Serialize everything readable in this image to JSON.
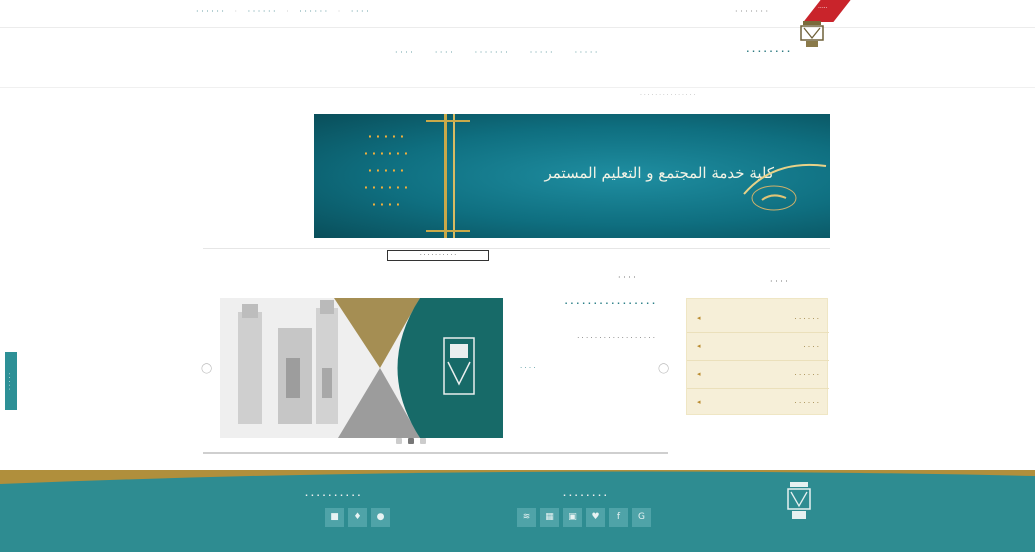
{
  "utility_bar": {
    "right_text": "· · · · · · ·",
    "ribbon": "·····",
    "links": [
      "· · · · · ·",
      "·",
      "· · · · · ·",
      "·",
      "· · · · · ·",
      "·",
      "· · · ·"
    ]
  },
  "header": {
    "university_name": "· · · · · · · ·",
    "nav": [
      "· · · · ·",
      "· · · · ·",
      "· · · · · · ·",
      "· · · ·",
      "· · · ·"
    ]
  },
  "breadcrumb": "· · · · · · · · · · · · · · ·",
  "banner": {
    "title": "كلية خدمة المجتمع و التعليم المستمر",
    "left_lines": [
      "· · · · ·",
      "· · · · · ·",
      "· · · · ·",
      "· · · · · ·",
      "· · · ·"
    ]
  },
  "caption": "· · · · · · · · · ·",
  "quick_links": {
    "title": "· · · ·",
    "items": [
      {
        "label": "· · · · · ·"
      },
      {
        "label": "· · · ·"
      },
      {
        "label": "· · · · · ·"
      },
      {
        "label": "· · · · · ·"
      }
    ]
  },
  "news": {
    "title": "· · · ·",
    "headline": "· · · · · · · · · · · · · · · ·",
    "body": "· · · · · · · · · · · · · · · · · ·",
    "more": "· · · ·"
  },
  "side_tab": "· · · · ·",
  "footer": {
    "social_title": "· · · · · · · ·",
    "app_title": "· · · · · · · · · ·",
    "social_icons": [
      "rss",
      "delicious",
      "instagram",
      "twitter",
      "facebook",
      "google-plus"
    ],
    "app_icons": [
      "windows",
      "android",
      "apple"
    ]
  },
  "colors": {
    "teal": "#2e8c91",
    "gold": "#b08f3c",
    "banner_teal": "#0f6f80",
    "quick_link_bg": "#f6efd8"
  }
}
